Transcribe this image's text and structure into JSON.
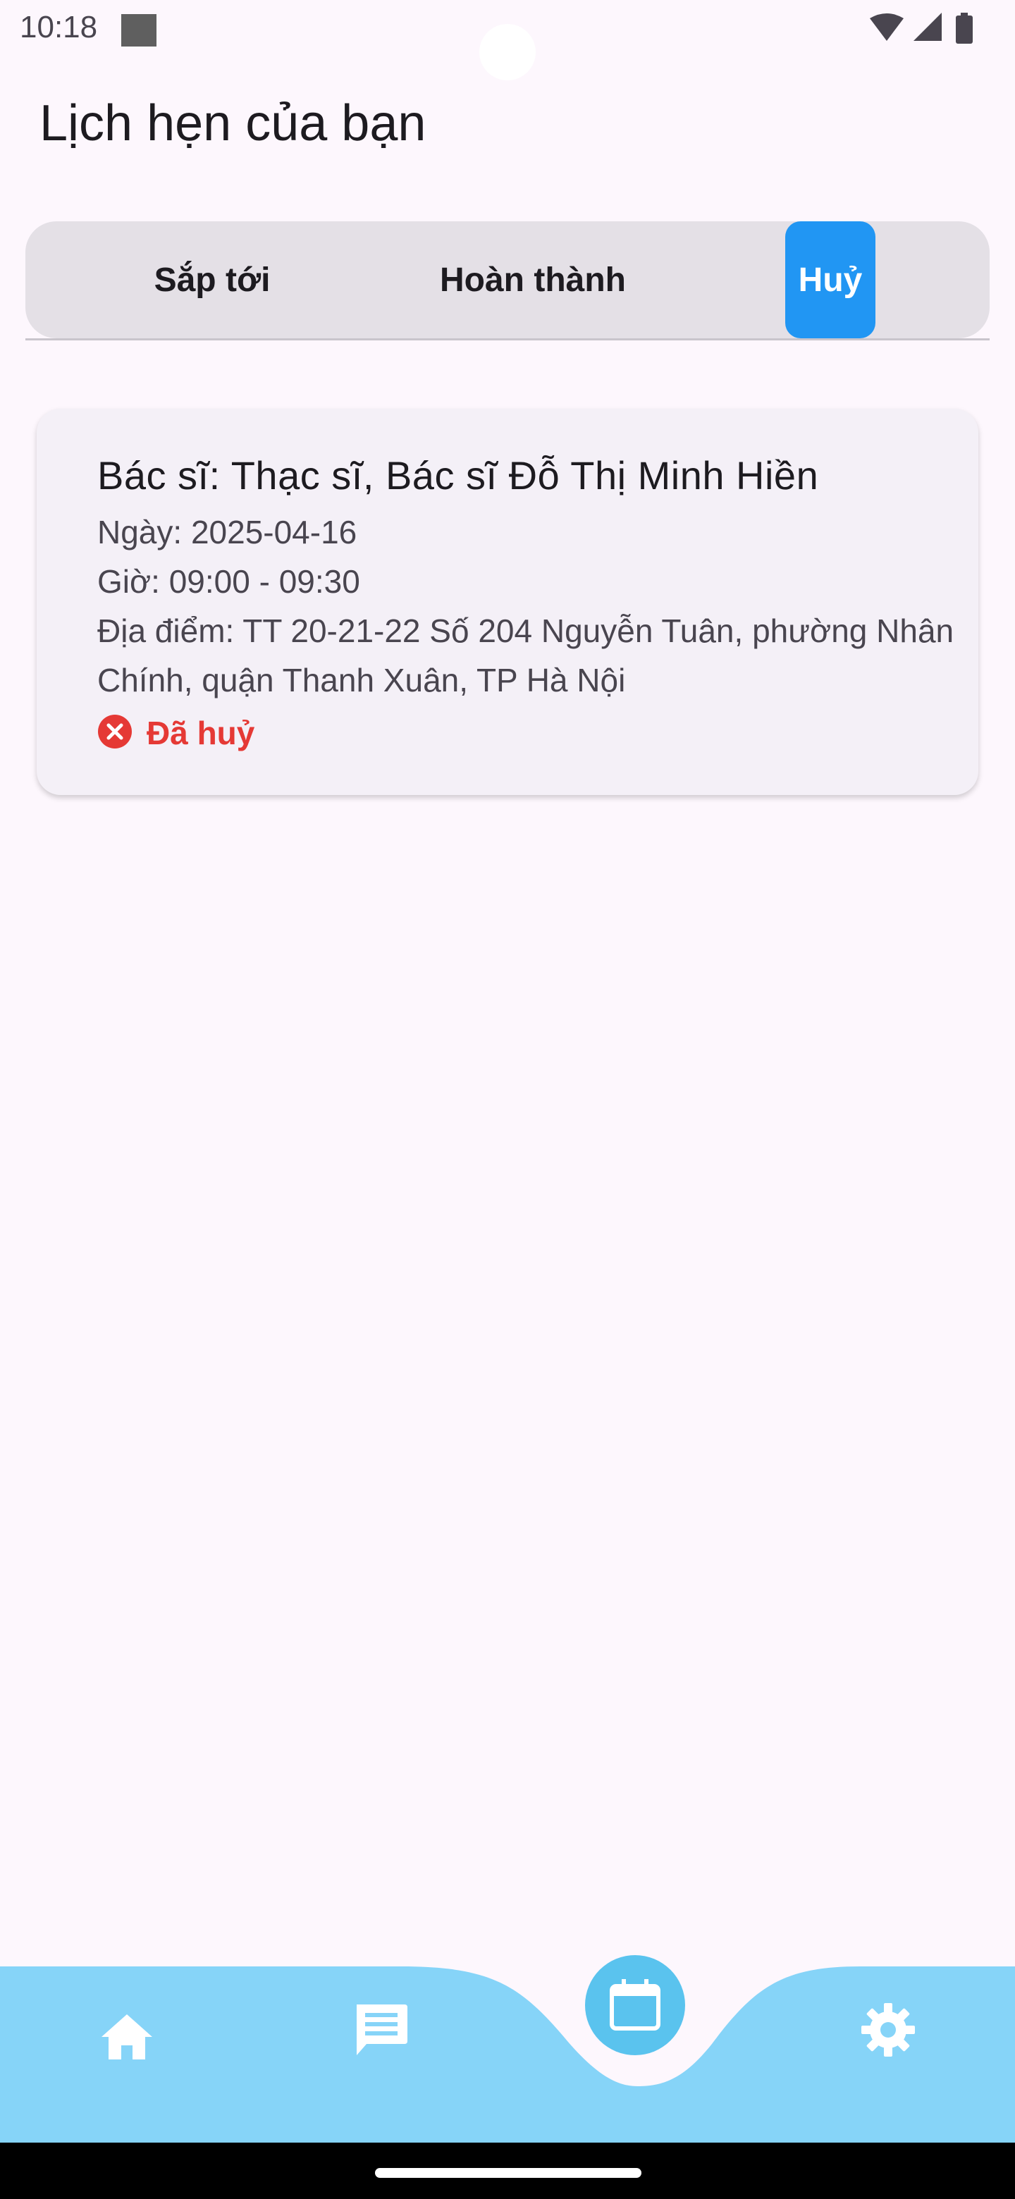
{
  "status_bar": {
    "time": "10:18"
  },
  "page": {
    "title": "Lịch hẹn của bạn"
  },
  "tabs": [
    {
      "label": "Sắp tới",
      "selected": false
    },
    {
      "label": "Hoàn thành",
      "selected": false
    },
    {
      "label": "Huỷ",
      "selected": true
    }
  ],
  "appointment": {
    "doctor": "Bác sĩ: Thạc sĩ, Bác sĩ Đỗ Thị Minh Hiền",
    "date": "Ngày: 2025-04-16",
    "time": "Giờ:  09:00 - 09:30",
    "address": "Địa điểm: TT 20-21-22 Số 204 Nguyễn Tuân, phường Nhân Chính, quận Thanh Xuân, TP Hà Nội",
    "status": "Đã huỷ",
    "status_icon": "cancel-circle-icon"
  },
  "bottom_nav": {
    "items": [
      {
        "icon": "home-icon",
        "active": false
      },
      {
        "icon": "message-icon",
        "active": false
      },
      {
        "icon": "calendar-icon",
        "active": true
      },
      {
        "icon": "settings-icon",
        "active": false
      }
    ]
  },
  "colors": {
    "background": "#fdf7fd",
    "tab_bar": "#e4e0e6",
    "tab_selected": "#2196f3",
    "card": "#f4f0f7",
    "status_cancelled": "#e53935",
    "nav_background": "#86d4f8",
    "nav_active": "#5ac3ee"
  }
}
